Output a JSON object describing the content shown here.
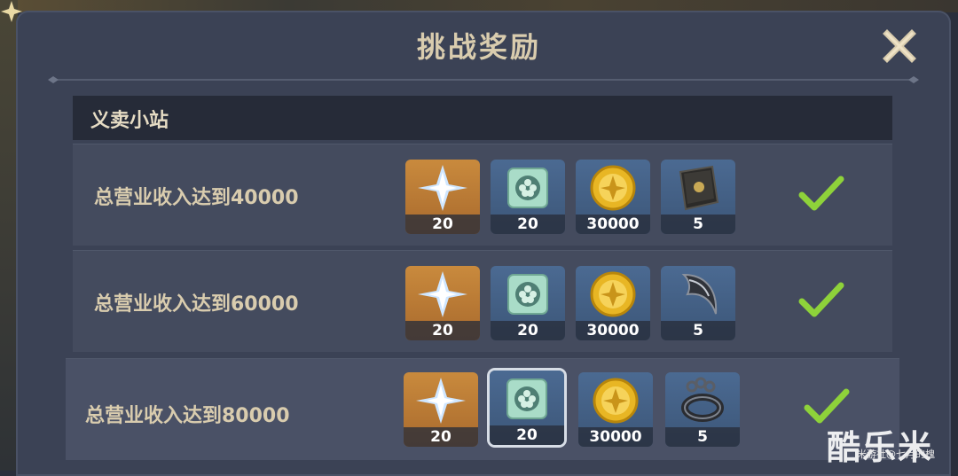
{
  "dialog": {
    "title": "挑战奖励",
    "section_title": "义卖小站"
  },
  "rows": [
    {
      "label": "总营业收入达到40000",
      "completed": true,
      "rewards": [
        {
          "icon": "primogem-icon",
          "count": "20"
        },
        {
          "icon": "token-icon",
          "count": "20"
        },
        {
          "icon": "mora-coin-icon",
          "count": "30000"
        },
        {
          "icon": "book-icon",
          "count": "5"
        }
      ]
    },
    {
      "label": "总营业收入达到60000",
      "completed": true,
      "rewards": [
        {
          "icon": "primogem-icon",
          "count": "20"
        },
        {
          "icon": "token-icon",
          "count": "20"
        },
        {
          "icon": "mora-coin-icon",
          "count": "30000"
        },
        {
          "icon": "horn-icon",
          "count": "5"
        }
      ]
    },
    {
      "label": "总营业收入达到80000",
      "completed": true,
      "rewards": [
        {
          "icon": "primogem-icon",
          "count": "20"
        },
        {
          "icon": "token-icon",
          "count": "20"
        },
        {
          "icon": "mora-coin-icon",
          "count": "30000"
        },
        {
          "icon": "chain-icon",
          "count": "5"
        }
      ]
    }
  ],
  "watermark": {
    "logo": "酷乐米",
    "sub": "米游社@七月的槐"
  },
  "colors": {
    "panel": "#3b4255",
    "header": "#262b38",
    "row": "#444b5e",
    "text": "#d9ccae",
    "check": "#8ed23a"
  }
}
